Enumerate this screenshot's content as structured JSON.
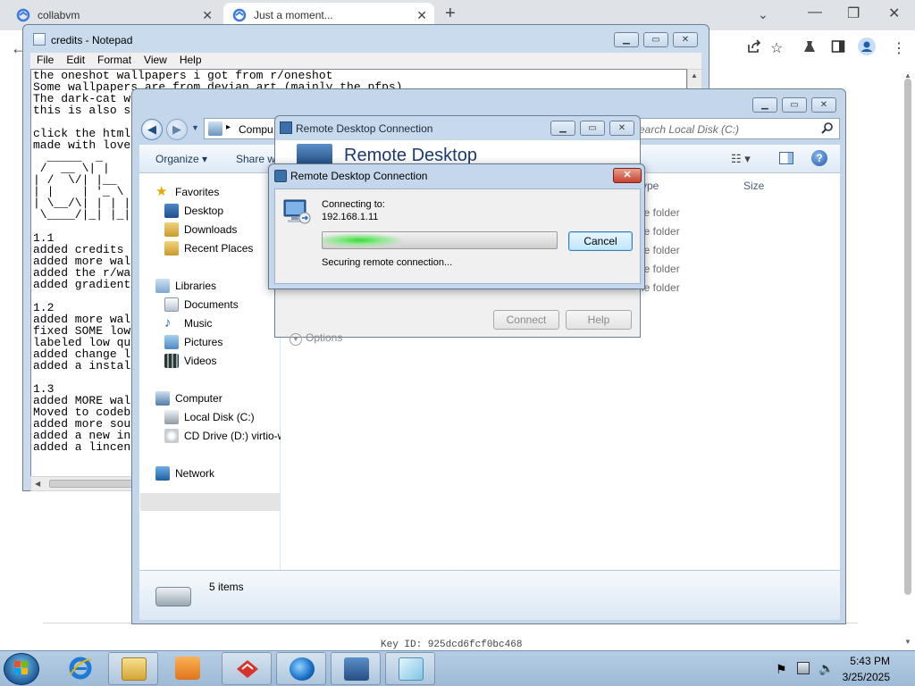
{
  "browser": {
    "tabs": [
      {
        "title": "collabvm"
      },
      {
        "title": "Just a moment..."
      }
    ],
    "new_tab": "+",
    "tab_search": "⌄",
    "minimize": "—",
    "restore": "❐",
    "close": "✕",
    "toolbar_icons": [
      "share-icon",
      "star-icon",
      "extension-icon",
      "sidepanel-icon",
      "profile-icon",
      "menu-icon"
    ]
  },
  "notepad": {
    "title": "credits - Notepad",
    "menu": [
      "File",
      "Edit",
      "Format",
      "View",
      "Help"
    ],
    "text": "the oneshot wallpapers i got from r/oneshot\nSome wallpapers are from devian art (mainly the pfps)\nThe dark-cat w\nthis is also s\n\nclick the html\nmade with love\n  _____  _\n /  __ \\| |\n| /  \\/| |__   __\n| |    | '_ \\ / _\n| \\__/\\| | | |\n \\____/|_| |_|\n\n1.1\nadded credits\nadded more wal\nadded the r/wa\nadded gradient\n\n1.2\nadded more wal\nfixed SOME low\nlabeled low qu\nadded change l\nadded a instal\n\n1.3\nadded MORE wal\nMoved to codeb\nadded more sou\nadded a new in\nadded a lincen"
  },
  "explorer": {
    "address": "Compu",
    "search_placeholder": "Search Local Disk (C:)",
    "commands": {
      "organize": "Organize ▾",
      "share": "Share w"
    },
    "nav": {
      "favorites": "Favorites",
      "desktop": "Desktop",
      "downloads": "Downloads",
      "recent": "Recent Places",
      "libraries": "Libraries",
      "documents": "Documents",
      "music": "Music",
      "pictures": "Pictures",
      "videos": "Videos",
      "computer": "Computer",
      "local_disk": "Local Disk (C:)",
      "cd_drive": "CD Drive (D:) virtio-w",
      "network": "Network"
    },
    "columns": {
      "type": "ype",
      "size": "Size"
    },
    "rows": [
      "le folder",
      "le folder",
      "le folder",
      "le folder",
      "le folder"
    ],
    "item_count": "5 items"
  },
  "rdc_main": {
    "title": "Remote Desktop Connection",
    "banner": "Remote Desktop",
    "options": "Options",
    "connect": "Connect",
    "help": "Help"
  },
  "rdc_dialog": {
    "title": "Remote Desktop Connection",
    "connecting_label": "Connecting to:",
    "ip": "192.168.1.11",
    "status": "Securing remote connection...",
    "cancel": "Cancel",
    "progress": 0.35
  },
  "vm_id": "Key ID: 925dcd6fcf0bc468",
  "clock": {
    "time": "5:43 PM",
    "date": "3/25/2025"
  },
  "colors": {
    "titlebar": "#c4d7ec",
    "progress_green": "#3bd83b",
    "taskbar": "#b5cde4"
  }
}
